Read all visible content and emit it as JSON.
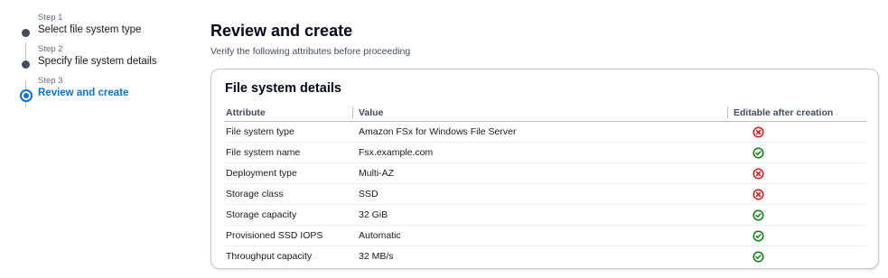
{
  "steps": [
    {
      "num": "Step 1",
      "title": "Select file system type",
      "state": "done"
    },
    {
      "num": "Step 2",
      "title": "Specify file system details",
      "state": "done"
    },
    {
      "num": "Step 3",
      "title": "Review and create",
      "state": "active"
    }
  ],
  "header": {
    "title": "Review and create",
    "description": "Verify the following attributes before proceeding"
  },
  "details": {
    "title": "File system details",
    "columns": [
      "Attribute",
      "Value",
      "Editable after creation"
    ],
    "rows": [
      {
        "attribute": "File system type",
        "value": "Amazon FSx for Windows File Server",
        "editable": "no",
        "icon": "x-circle-icon"
      },
      {
        "attribute": "File system name",
        "value": "Fsx.example.com",
        "editable": "yes",
        "icon": "check-circle-icon"
      },
      {
        "attribute": "Deployment type",
        "value": "Multi-AZ",
        "editable": "no",
        "icon": "x-circle-icon"
      },
      {
        "attribute": "Storage class",
        "value": "SSD",
        "editable": "no",
        "icon": "x-circle-icon"
      },
      {
        "attribute": "Storage capacity",
        "value": "32 GiB",
        "editable": "yes",
        "icon": "check-circle-icon"
      },
      {
        "attribute": "Provisioned SSD IOPS",
        "value": "Automatic",
        "editable": "yes",
        "icon": "check-circle-icon"
      },
      {
        "attribute": "Throughput capacity",
        "value": "32 MB/s",
        "editable": "yes",
        "icon": "check-circle-icon"
      }
    ]
  },
  "colors": {
    "accent": "#0972d3",
    "success": "#037f0c",
    "error": "#d91515"
  }
}
